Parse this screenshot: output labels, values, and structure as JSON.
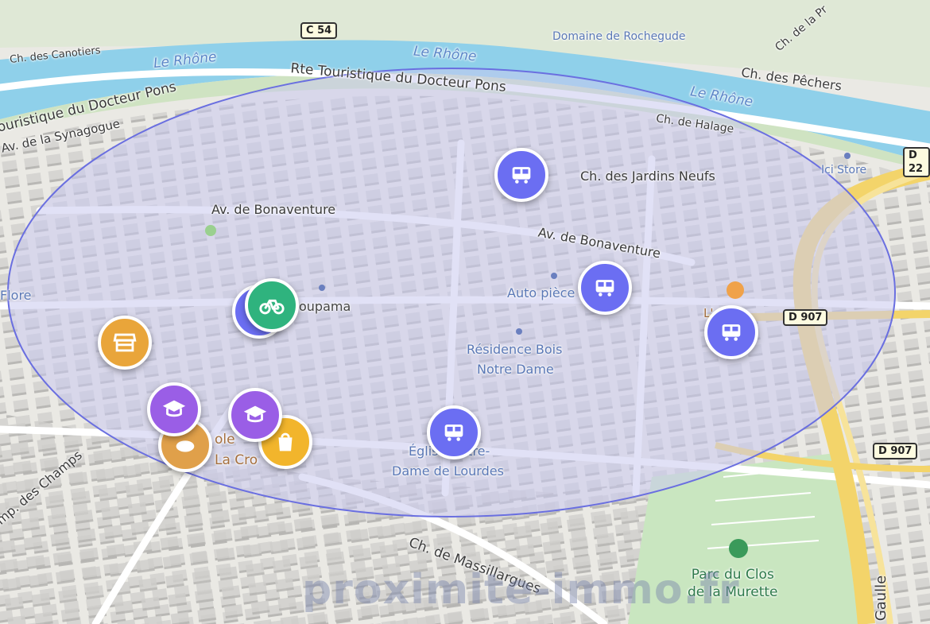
{
  "roads": {
    "canotiers": "Ch. des Canotiers",
    "c54": "C 54",
    "rte_touristique": "Rte Touristique du Docteur Pons",
    "rte_touristique_left": "ouristique du Docteur Pons",
    "synagogue": "Av. de la Synagogue",
    "bonaventure_1": "Av. de Bonaventure",
    "bonaventure_2": "Av. de Bonaventure",
    "jardins_neufs": "Ch. des Jardins Neufs",
    "halage": "Ch. de Halage",
    "pechers": "Ch. des Pêchers",
    "de_la_pr": "Ch. de la Pr",
    "d22": "D 22",
    "d907_a": "D 907",
    "d907_b": "D 907",
    "massillargues": "Ch. de Massillargues",
    "champs": "Imp. des Champs",
    "gaulle": "Gaulle"
  },
  "water": {
    "rhone_1": "Le Rhône",
    "rhone_2": "Le Rhône",
    "rhone_3": "Le Rhône"
  },
  "pois": {
    "rochegude": "Domaine de Rochegude",
    "ici_store": "Ici Store",
    "flore": "Flore",
    "groupama": "oupama",
    "auto_pieces": "Auto pièce",
    "residence_1": "Résidence Bois",
    "residence_2": "Notre Dame",
    "eglise_1": "Église Notre-",
    "eglise_2": "Dame de Lourdes",
    "ecole_1": "ole",
    "ecole_2": "La Cro",
    "grill": "L' Grill",
    "parc_1": "Parc du Clos",
    "parc_2": "de la Murette"
  },
  "markers": [
    {
      "name": "bus-marker",
      "icon": "bus-icon",
      "color": "#6b6ef2"
    },
    {
      "name": "bus-marker",
      "icon": "bus-icon",
      "color": "#6b6ef2"
    },
    {
      "name": "bus-marker",
      "icon": "bus-icon",
      "color": "#6b6ef2"
    },
    {
      "name": "bus-marker",
      "icon": "bus-icon",
      "color": "#6b6ef2"
    },
    {
      "name": "bike-marker",
      "icon": "bicycle-icon",
      "color": "#2fb37e"
    },
    {
      "name": "shop-marker",
      "icon": "store-icon",
      "color": "#e9a53a"
    },
    {
      "name": "school-marker",
      "icon": "graduation-cap-icon",
      "color": "#9a5ee6"
    },
    {
      "name": "school-marker",
      "icon": "graduation-cap-icon",
      "color": "#9a5ee6"
    },
    {
      "name": "bakery-marker",
      "icon": "bread-icon",
      "color": "#e0a04a"
    },
    {
      "name": "grocery-marker",
      "icon": "shopping-bag-icon",
      "color": "#f2b52c"
    }
  ],
  "colors": {
    "radius_fill": "#c9c8ef",
    "radius_stroke": "#6a6fe0",
    "river": "#8fd0ea",
    "highway": "#f3d46a",
    "park": "#c9e6c0"
  },
  "watermark": "proximite-immo.fr"
}
